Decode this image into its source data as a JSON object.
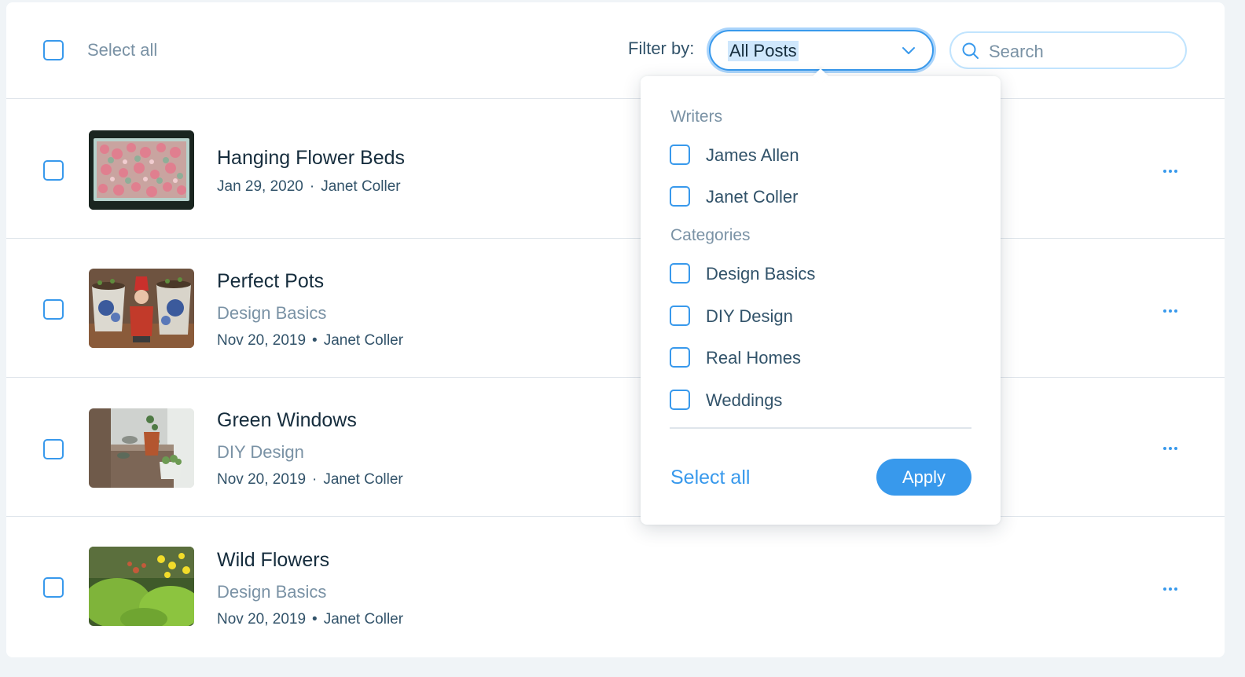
{
  "header": {
    "select_all_label": "Select all",
    "filter_label": "Filter by:",
    "filter_value": "All Posts",
    "search_placeholder": "Search"
  },
  "posts": [
    {
      "title": "Hanging Flower Beds",
      "category": "",
      "date": "Jan 29, 2020",
      "separator": "·",
      "author": "Janet Coller"
    },
    {
      "title": "Perfect Pots",
      "category": "Design Basics",
      "date": "Nov 20, 2019",
      "separator": "•",
      "author": "Janet Coller"
    },
    {
      "title": "Green Windows",
      "category": "DIY Design",
      "date": "Nov 20, 2019",
      "separator": "·",
      "author": "Janet Coller"
    },
    {
      "title": "Wild Flowers",
      "category": "Design Basics",
      "date": "Nov 20, 2019",
      "separator": "•",
      "author": "Janet Coller"
    }
  ],
  "filter_dropdown": {
    "writers_title": "Writers",
    "writers": [
      "James Allen",
      "Janet Coller"
    ],
    "categories_title": "Categories",
    "categories": [
      "Design Basics",
      "DIY Design",
      "Real Homes",
      "Weddings"
    ],
    "select_all_label": "Select all",
    "apply_label": "Apply"
  },
  "colors": {
    "accent": "#3899ec",
    "text_dark": "#162d3d",
    "text_muted": "#7a92a5",
    "divider": "#dfe5eb",
    "page_bg": "#f0f4f7"
  },
  "icons": {
    "filter_chevron": "chevron-down-icon",
    "search": "search-icon",
    "row_menu": "more-horizontal-icon"
  }
}
